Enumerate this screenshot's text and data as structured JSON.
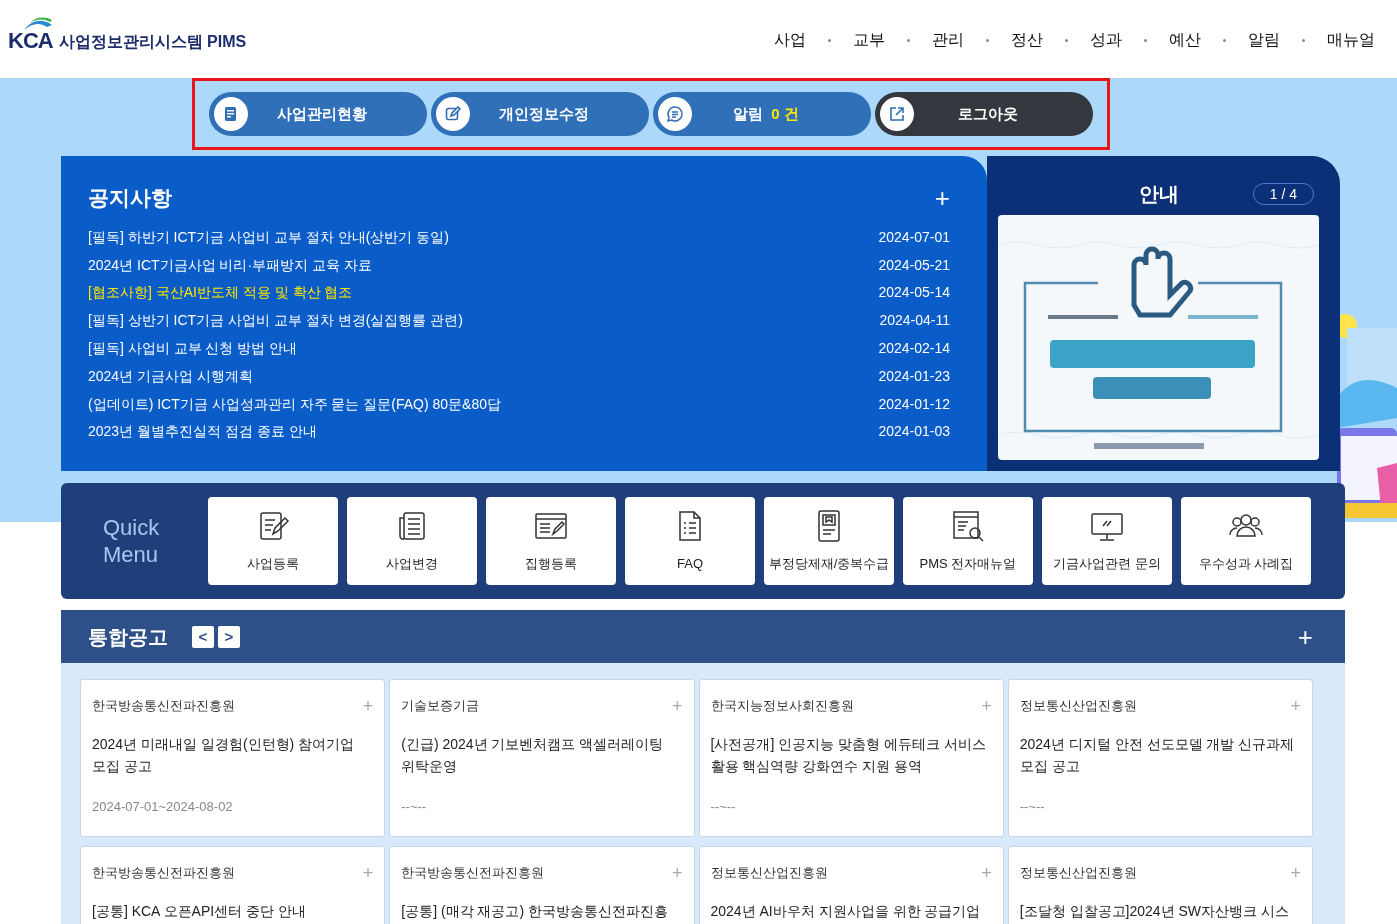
{
  "header": {
    "logo_text": "KCA",
    "system_name": "사업정보관리시스템 PIMS",
    "nav": [
      "사업",
      "교부",
      "관리",
      "정산",
      "성과",
      "예산",
      "알림",
      "매뉴얼"
    ]
  },
  "action_bar": {
    "highlighted": true,
    "buttons": [
      {
        "kind": "status",
        "label": "사업관리현황"
      },
      {
        "kind": "profile",
        "label": "개인정보수정"
      },
      {
        "kind": "alert",
        "label": "알림",
        "count": "0 건"
      },
      {
        "kind": "logout",
        "label": "로그아웃"
      }
    ]
  },
  "notices": {
    "title": "공지사항",
    "more": "+",
    "items": [
      {
        "title": "[필독] 하반기 ICT기금 사업비 교부 절차 안내(상반기 동일)",
        "date": "2024-07-01",
        "highlighted": false
      },
      {
        "title": "2024년 ICT기금사업 비리·부패방지 교육 자료",
        "date": "2024-05-21",
        "highlighted": false
      },
      {
        "title": "[협조사항] 국산AI반도체 적용 및 확산 협조",
        "date": "2024-05-14",
        "highlighted": true
      },
      {
        "title": "[필독] 상반기 ICT기금 사업비 교부 절차 변경(실집행률 관련)",
        "date": "2024-04-11",
        "highlighted": false
      },
      {
        "title": "[필독] 사업비 교부 신청 방법 안내",
        "date": "2024-02-14",
        "highlighted": false
      },
      {
        "title": "2024년 기금사업 시행계획",
        "date": "2024-01-23",
        "highlighted": false
      },
      {
        "title": "(업데이트) ICT기금 사업성과관리 자주 묻는 질문(FAQ) 80문&80답",
        "date": "2024-01-12",
        "highlighted": false
      },
      {
        "title": "2023년 월별추진실적 점검 종료 안내",
        "date": "2024-01-03",
        "highlighted": false
      }
    ]
  },
  "guide": {
    "title": "안내",
    "pager": "1 / 4"
  },
  "quick_menu": {
    "title_line1": "Quick",
    "title_line2": "Menu",
    "items": [
      {
        "kind": "edit-doc",
        "label": "사업등록"
      },
      {
        "kind": "news",
        "label": "사업변경"
      },
      {
        "kind": "browser-edit",
        "label": "집행등록"
      },
      {
        "kind": "list-doc",
        "label": "FAQ"
      },
      {
        "kind": "tablet",
        "label": "부정당제재/중복수급"
      },
      {
        "kind": "search-doc",
        "label": "PMS 전자매뉴얼"
      },
      {
        "kind": "monitor",
        "label": "기금사업관련 문의"
      },
      {
        "kind": "people",
        "label": "우수성과 사례집"
      }
    ]
  },
  "announcements": {
    "title": "통합공고",
    "prev": "<",
    "next": ">",
    "more": "+",
    "cards": [
      {
        "org": "한국방송통신전파진흥원",
        "title": "2024년 미래내일 일경험(인턴형) 참여기업 모집 공고",
        "period": "2024-07-01~2024-08-02"
      },
      {
        "org": "기술보증기금",
        "title": "(긴급) 2024년 기보벤처캠프 액셀러레이팅 위탁운영",
        "period": "--~--"
      },
      {
        "org": "한국지능정보사회진흥원",
        "title": "[사전공개] 인공지능 맞춤형 에듀테크 서비스 활용 핵심역량 강화연수 지원 용역",
        "period": "--~--"
      },
      {
        "org": "정보통신산업진흥원",
        "title": "2024년 디지털 안전 선도모델 개발 신규과제 모집 공고",
        "period": "--~--"
      },
      {
        "org": "한국방송통신전파진흥원",
        "title": "[공통] KCA 오픈API센터 중단 안내"
      },
      {
        "org": "한국방송통신전파진흥원",
        "title": "[공통] (매각 재공고) 한국방송통신전파진흥"
      },
      {
        "org": "정보통신산업진흥원",
        "title": "2024년 AI바우처 지원사업을 위한 공급기업"
      },
      {
        "org": "정보통신산업진흥원",
        "title": "[조달청 입찰공고]2024년 SW자산뱅크 시스"
      }
    ]
  }
}
